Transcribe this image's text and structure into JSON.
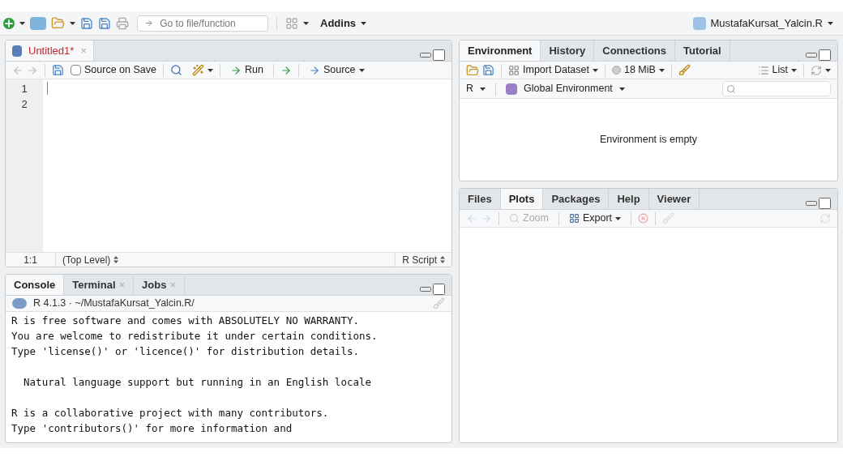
{
  "main_toolbar": {
    "goto_placeholder": "Go to file/function",
    "addins": "Addins",
    "project": "MustafaKursat_Yalcin.R"
  },
  "source": {
    "tabs": [
      {
        "label": "Untitled1*",
        "selected": true,
        "modified": true,
        "close": "×"
      }
    ],
    "toolbar": {
      "source_on_save": {
        "label": "Source on Save",
        "checked": false
      },
      "run": "Run",
      "source": "Source"
    },
    "line_numbers": [
      "1",
      "2"
    ],
    "status": {
      "position": "1:1",
      "scope": "(Top Level)",
      "type": "R Script"
    }
  },
  "console": {
    "tabs": [
      {
        "label": "Console",
        "selected": true
      },
      {
        "label": "Terminal",
        "selected": false,
        "close": "×"
      },
      {
        "label": "Jobs",
        "selected": false,
        "close": "×"
      }
    ],
    "header": "R 4.1.3 · ~/MustafaKursat_Yalcin.R/",
    "paragraphs": [
      [
        "R is free software and comes with ABSOLUTELY NO WARRANTY.",
        "You are welcome to redistribute it under certain conditions.",
        "Type 'license()' or 'licence()' for distribution details."
      ],
      [
        "  Natural language support but running in an English locale"
      ],
      [
        "R is a collaborative project with many contributors.",
        "Type 'contributors()' for more information and"
      ]
    ]
  },
  "environment": {
    "tabs": [
      {
        "label": "Environment",
        "selected": true
      },
      {
        "label": "History",
        "selected": false
      },
      {
        "label": "Connections",
        "selected": false
      },
      {
        "label": "Tutorial",
        "selected": false
      }
    ],
    "toolbar": {
      "import": "Import Dataset",
      "memory": "18 MiB",
      "view": "List"
    },
    "language": "R",
    "scope": "Global Environment",
    "message": "Environment is empty"
  },
  "files": {
    "tabs": [
      {
        "label": "Files",
        "selected": false
      },
      {
        "label": "Plots",
        "selected": true
      },
      {
        "label": "Packages",
        "selected": false
      },
      {
        "label": "Help",
        "selected": false
      },
      {
        "label": "Viewer",
        "selected": false
      }
    ],
    "toolbar": {
      "zoom": {
        "label": "Zoom",
        "disabled": true
      },
      "export": {
        "label": "Export",
        "disabled": false
      }
    }
  }
}
